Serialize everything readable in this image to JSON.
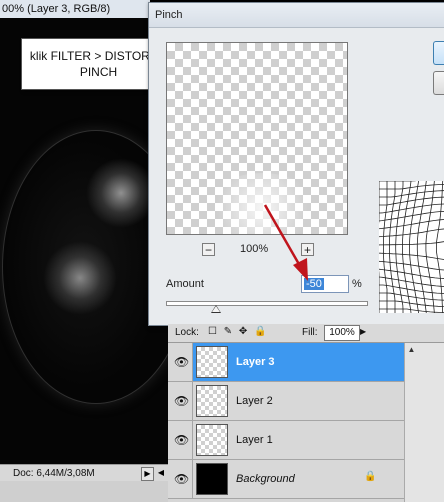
{
  "canvas": {
    "title": "00% (Layer 3, RGB/8)",
    "status_doc": "Doc: 6,44M/3,08M",
    "status_arrow": "▶",
    "scroll_left": "◀"
  },
  "annotation": {
    "line1": "klik FILTER > DISTORT >",
    "line2": "PINCH"
  },
  "dialog": {
    "title": "Pinch",
    "zoom_minus": "−",
    "zoom_plus": "+",
    "zoom_level": "100%",
    "amount_label": "Amount",
    "amount_value": "-50",
    "amount_unit": "%",
    "slider_fraction": 0.25
  },
  "layers_panel": {
    "lock_label": "Lock:",
    "lock_icons": "☐ ✎ ✥ 🔒",
    "fill_label": "Fill:",
    "fill_value": "100%",
    "layers": [
      {
        "name": "Layer 3",
        "selected": true,
        "thumbnail": "transparent"
      },
      {
        "name": "Layer 2",
        "selected": false,
        "thumbnail": "transparent"
      },
      {
        "name": "Layer 1",
        "selected": false,
        "thumbnail": "transparent"
      },
      {
        "name": "Background",
        "selected": false,
        "thumbnail": "black",
        "locked": true
      }
    ],
    "eye_glyph": "👁",
    "lock_glyph": "🔒"
  },
  "colors": {
    "selection": "#3d98f0",
    "arrow": "#c0141c"
  }
}
